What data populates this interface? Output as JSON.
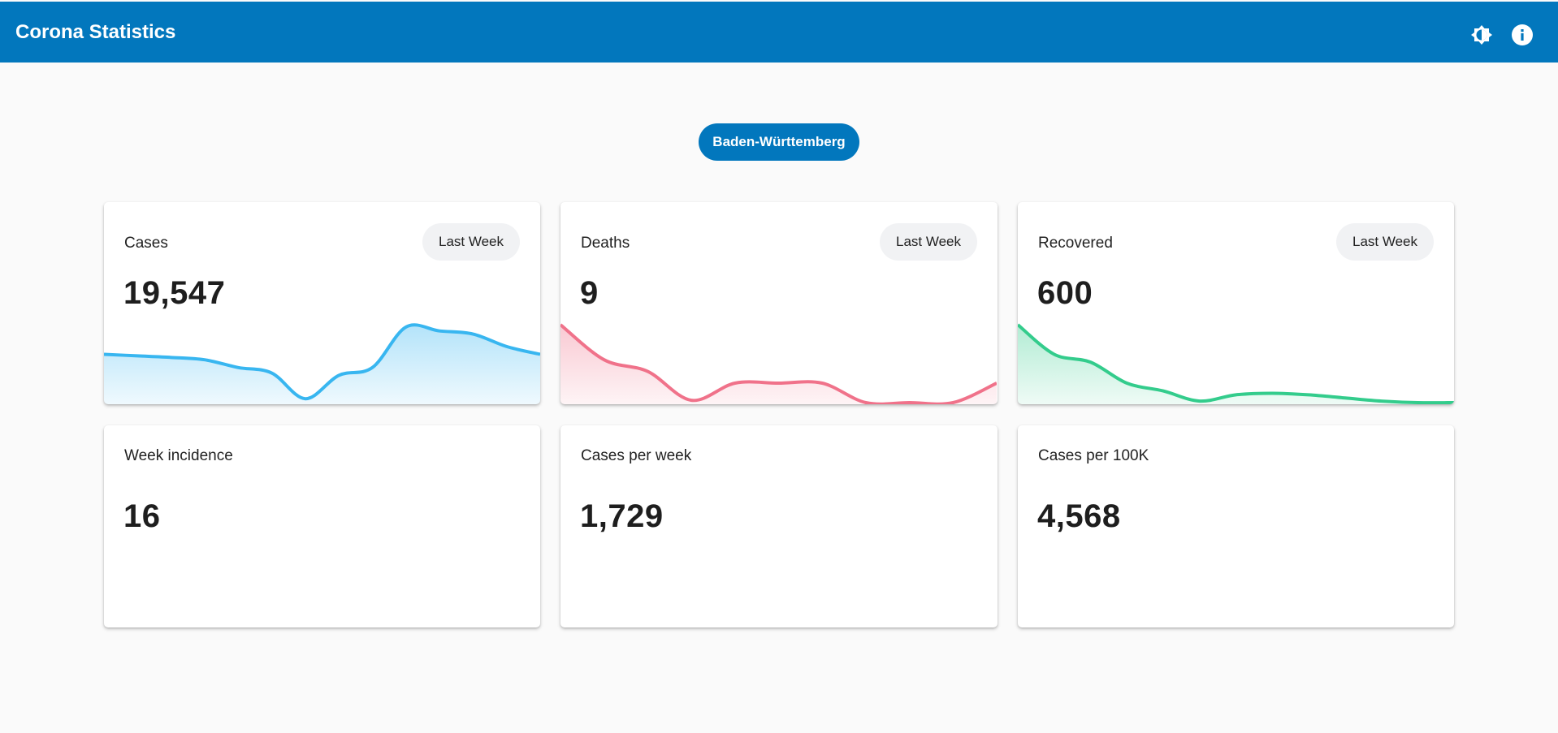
{
  "header": {
    "title": "Corona Statistics",
    "icons": [
      "brightness-icon",
      "info-icon"
    ]
  },
  "region": {
    "label": "Baden-Württemberg"
  },
  "colors": {
    "primary": "#0277bd",
    "cases": "#38b6f0",
    "deaths": "#f0728a",
    "recovered": "#33cc8c"
  },
  "cards_top": [
    {
      "title": "Cases",
      "value": "19,547",
      "range_label": "Last Week",
      "trend": [
        0.62,
        0.6,
        0.58,
        0.55,
        0.45,
        0.38,
        0.05,
        0.35,
        0.45,
        0.97,
        0.92,
        0.88,
        0.72,
        0.62
      ]
    },
    {
      "title": "Deaths",
      "value": "9",
      "range_label": "Last Week",
      "trend": [
        1.0,
        0.55,
        0.4,
        0.03,
        0.25,
        0.25,
        0.25,
        0.0,
        0.0,
        0.0,
        0.25
      ]
    },
    {
      "title": "Recovered",
      "value": "600",
      "range_label": "Last Week",
      "trend": [
        1.0,
        0.62,
        0.52,
        0.25,
        0.15,
        0.02,
        0.1,
        0.12,
        0.1,
        0.06,
        0.02,
        0.0,
        0.0
      ]
    }
  ],
  "cards_bottom": [
    {
      "title": "Week incidence",
      "value": "16"
    },
    {
      "title": "Cases per week",
      "value": "1,729"
    },
    {
      "title": "Cases per 100K",
      "value": "4,568"
    }
  ]
}
